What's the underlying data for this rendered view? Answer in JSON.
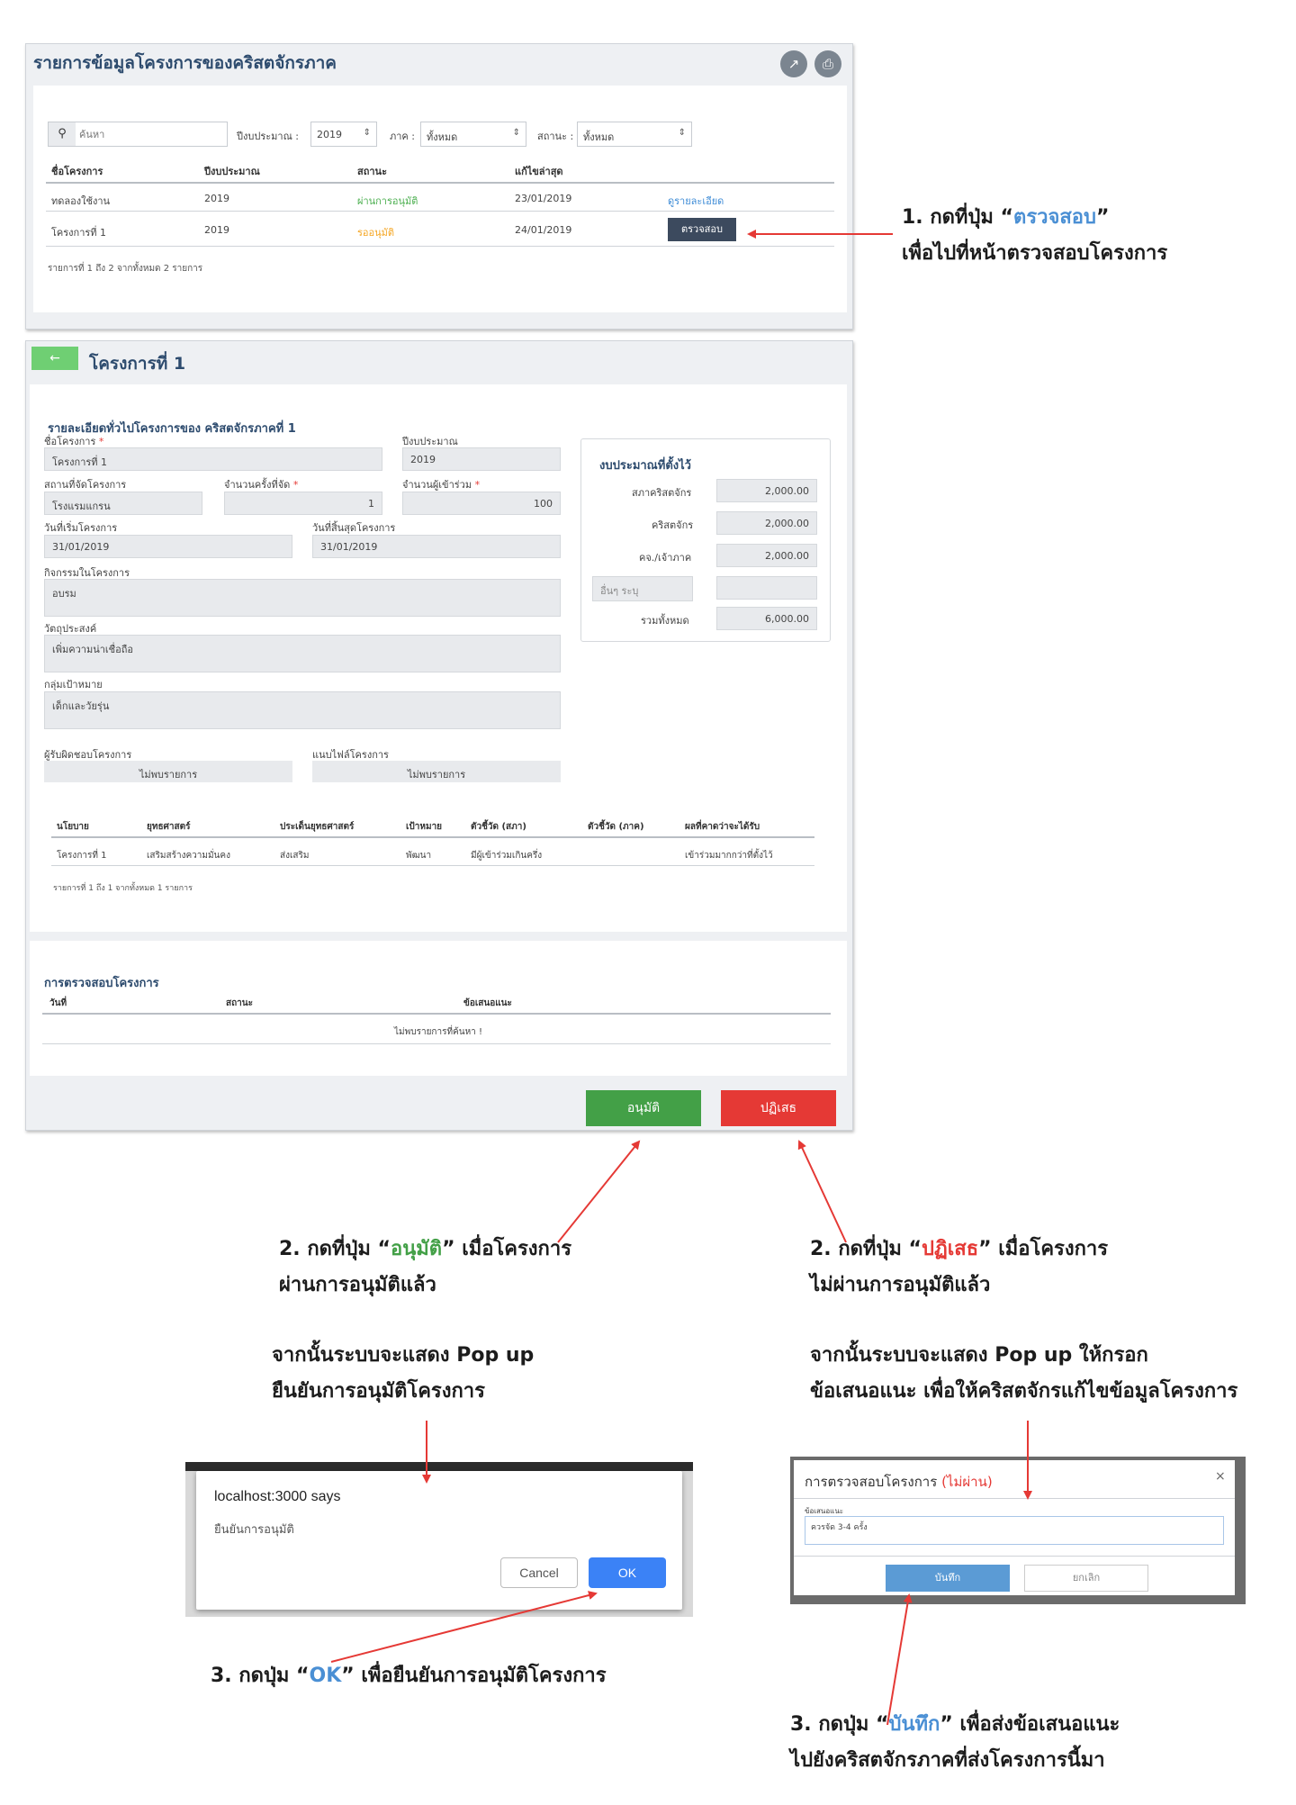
{
  "list_panel": {
    "title": "รายการข้อมูลโครงการของคริสตจักรภาค",
    "icons": {
      "export": "external-link-icon",
      "print": "print-icon"
    },
    "search_placeholder": "ค้นหา",
    "filters": {
      "year_label": "ปีงบประมาณ :",
      "year_value": "2019",
      "region_label": "ภาค :",
      "region_value": "ทั้งหมด",
      "status_label": "สถานะ :",
      "status_value": "ทั้งหมด"
    },
    "columns": [
      "ชื่อโครงการ",
      "ปีงบประมาณ",
      "สถานะ",
      "แก้ไขล่าสุด"
    ],
    "rows": [
      {
        "name": "ทดลองใช้งาน",
        "year": "2019",
        "status": "ผ่านการอนุมัติ",
        "updated": "23/01/2019",
        "action": "ดูรายละเอียด"
      },
      {
        "name": "โครงการที่ 1",
        "year": "2019",
        "status": "รออนุมัติ",
        "updated": "24/01/2019",
        "action": "ตรวจสอบ"
      }
    ],
    "footer": "รายการที่ 1 ถึง 2 จากทั้งหมด 2 รายการ"
  },
  "detail_panel": {
    "back_icon": "arrow-left-icon",
    "title": "โครงการที่ 1",
    "section_title": "รายละเอียดทั่วไปโครงการของ คริสตจักรภาคที่ 1",
    "fields": {
      "project_name_label": "ชื่อโครงการ",
      "project_name": "โครงการที่ 1",
      "budget_year_label": "ปีงบประมาณ",
      "budget_year": "2019",
      "venue_label": "สถานที่จัดโครงการ",
      "venue": "โรงแรมแกรน",
      "times_label": "จำนวนครั้งที่จัด",
      "times": "1",
      "participants_label": "จำนวนผู้เข้าร่วม",
      "participants": "100",
      "start_label": "วันที่เริ่มโครงการ",
      "start": "31/01/2019",
      "end_label": "วันที่สิ้นสุดโครงการ",
      "end": "31/01/2019",
      "activity_label": "กิจกรรมในโครงการ",
      "activity": "อบรม",
      "objective_label": "วัตถุประสงค์",
      "objective": "เพิ่มความน่าเชื่อถือ",
      "target_label": "กลุ่มเป้าหมาย",
      "target": "เด็กและวัยรุ่น",
      "owner_label": "ผู้รับผิดชอบโครงการ",
      "owner": "ไม่พบรายการ",
      "attach_label": "แนบไฟล์โครงการ",
      "attach": "ไม่พบรายการ"
    },
    "budget": {
      "title": "งบประมาณที่ตั้งไว้",
      "rows": [
        {
          "label": "สภาคริสตจักร",
          "value": "2,000.00"
        },
        {
          "label": "คริสตจักร",
          "value": "2,000.00"
        },
        {
          "label": "คจ./เจ้าภาค",
          "value": "2,000.00"
        }
      ],
      "other_placeholder": "อื่นๆ ระบุ",
      "other_value": "",
      "total_label": "รวมทั้งหมด",
      "total": "6,000.00"
    },
    "strategy_columns": [
      "นโยบาย",
      "ยุทธศาสตร์",
      "ประเด็นยุทธศาสตร์",
      "เป้าหมาย",
      "ตัวชี้วัด (สภา)",
      "ตัวชี้วัด (ภาค)",
      "ผลที่คาดว่าจะได้รับ"
    ],
    "strategy_row": [
      "โครงการที่ 1",
      "เสริมสร้างความมั่นคง",
      "ส่งเสริม",
      "พัฒนา",
      "มีผู้เข้าร่วมเกินครึ่ง",
      "",
      "เข้าร่วมมากกว่าที่ตั้งไว้"
    ],
    "strategy_footer": "รายการที่ 1 ถึง 1 จากทั้งหมด 1 รายการ",
    "review_title": "การตรวจสอบโครงการ",
    "review_columns": [
      "วันที่",
      "สถานะ",
      "ข้อเสนอแนะ"
    ],
    "review_empty": "ไม่พบรายการที่ค้นหา !",
    "approve_label": "อนุมัติ",
    "reject_label": "ปฏิเสธ"
  },
  "annotations": {
    "step1_pre": "1. กดที่ปุ่ม “",
    "step1_hl": "ตรวจสอบ",
    "step1_post": "”",
    "step1_line2": "เพื่อไปที่หน้าตรวจสอบโครงการ",
    "step2a_pre": "2. กดที่ปุ่ม “",
    "step2a_hl": "อนุมัติ",
    "step2a_post": "” เมื่อโครงการ",
    "step2a_line2": "ผ่านการอนุมัติแล้ว",
    "step2b_pre": "2. กดที่ปุ่ม “",
    "step2b_hl": "ปฏิเสธ",
    "step2b_post": "” เมื่อโครงการ",
    "step2b_line2": "ไม่ผ่านการอนุมัติแล้ว",
    "popup_a_line1": "จากนั้นระบบจะแสดง Pop up",
    "popup_a_line2": "ยืนยันการอนุมัติโครงการ",
    "popup_b_line1": "จากนั้นระบบจะแสดง Pop up  ให้กรอก",
    "popup_b_line2": "ข้อเสนอแนะ เพื่อให้คริสตจักรแก้ไขข้อมูลโครงการ",
    "step3a_pre": "3. กดปุ่ม “",
    "step3a_hl": "OK",
    "step3a_post": "” เพื่อยืนยันการอนุมัติโครงการ",
    "step3b_pre": "3. กดปุ่ม “",
    "step3b_hl": "บันทึก",
    "step3b_post": "” เพื่อส่งข้อเสนอแนะ",
    "step3b_line2": "ไปยังคริสตจักรภาคที่ส่งโครงการนี้มา"
  },
  "confirm_dialog": {
    "title": "localhost:3000 says",
    "message": "ยืนยันการอนุมัติ",
    "cancel": "Cancel",
    "ok": "OK"
  },
  "reject_dialog": {
    "title": "การตรวจสอบโครงการ",
    "status": "(ไม่ผ่าน)",
    "close": "×",
    "field_label": "ข้อเสนอแนะ",
    "field_value": "ควรจัด 3-4 ครั้ง",
    "save": "บันทึก",
    "cancel": "ยกเลิก"
  },
  "colors": {
    "title_blue": "#2d4b6e",
    "approved_green": "#4caf50",
    "pending_orange": "#f5a623",
    "link_blue": "#3d8bd6",
    "btn_dark": "#3c4a5e",
    "approve_green": "#43a047",
    "reject_red": "#e53935",
    "arrow_red": "#e53935"
  }
}
